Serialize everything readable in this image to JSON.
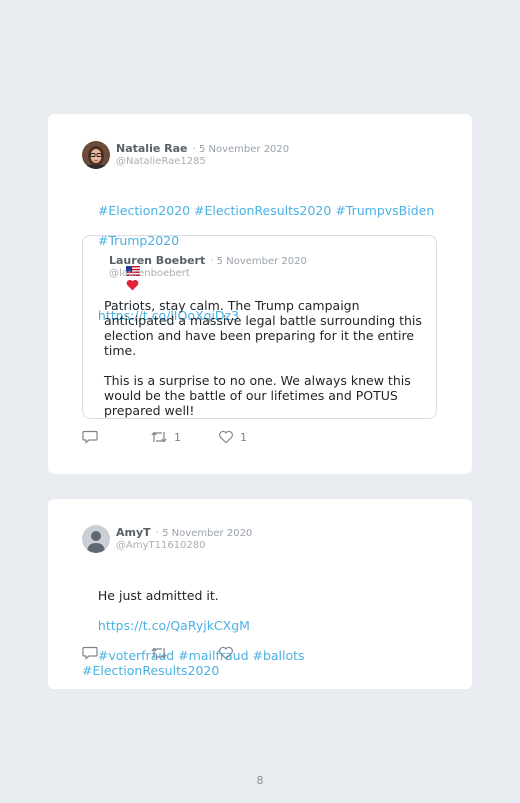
{
  "tweets": [
    {
      "name": "Natalie Rae",
      "date": "· 5 November 2020",
      "handle": "@NatalieRae1285",
      "text_line1": "#Election2020 #ElectionResults2020 #TrumpvsBiden",
      "text_line2": "#Trump2020",
      "flag_emoji": "🇺🇸❤️",
      "link": "https://t.co/lIOoXqiDz3",
      "quote": {
        "name": "Lauren Boebert",
        "date": "· 5 November 2020",
        "handle": "@laurenboebert",
        "text": "Patriots, stay calm. The Trump campaign anticipated a massive legal battle surrounding this election and have been preparing for it the entire time.\n\nThis is a surprise to no one. We always knew this would be the battle of our lifetimes and POTUS prepared well!"
      },
      "retweets": "1",
      "likes": "1"
    },
    {
      "name": "AmyT",
      "date": "· 5 November 2020",
      "handle": "@AmyT11610280",
      "text": "He just admitted it.",
      "link": "https://t.co/QaRyjkCXgM",
      "hashtags": "#voterfraud #mailfraud #ballots #ElectionResults2020",
      "retweets": "",
      "likes": ""
    }
  ],
  "page_number": "8",
  "colors": {
    "background": "#e9ecf0",
    "card": "#ffffff",
    "link": "#4ab1e3",
    "icon": "#7d858c"
  },
  "icons": [
    "reply-icon",
    "retweet-icon",
    "heart-icon",
    "us-flag-icon",
    "red-heart-icon",
    "default-avatar-icon"
  ]
}
